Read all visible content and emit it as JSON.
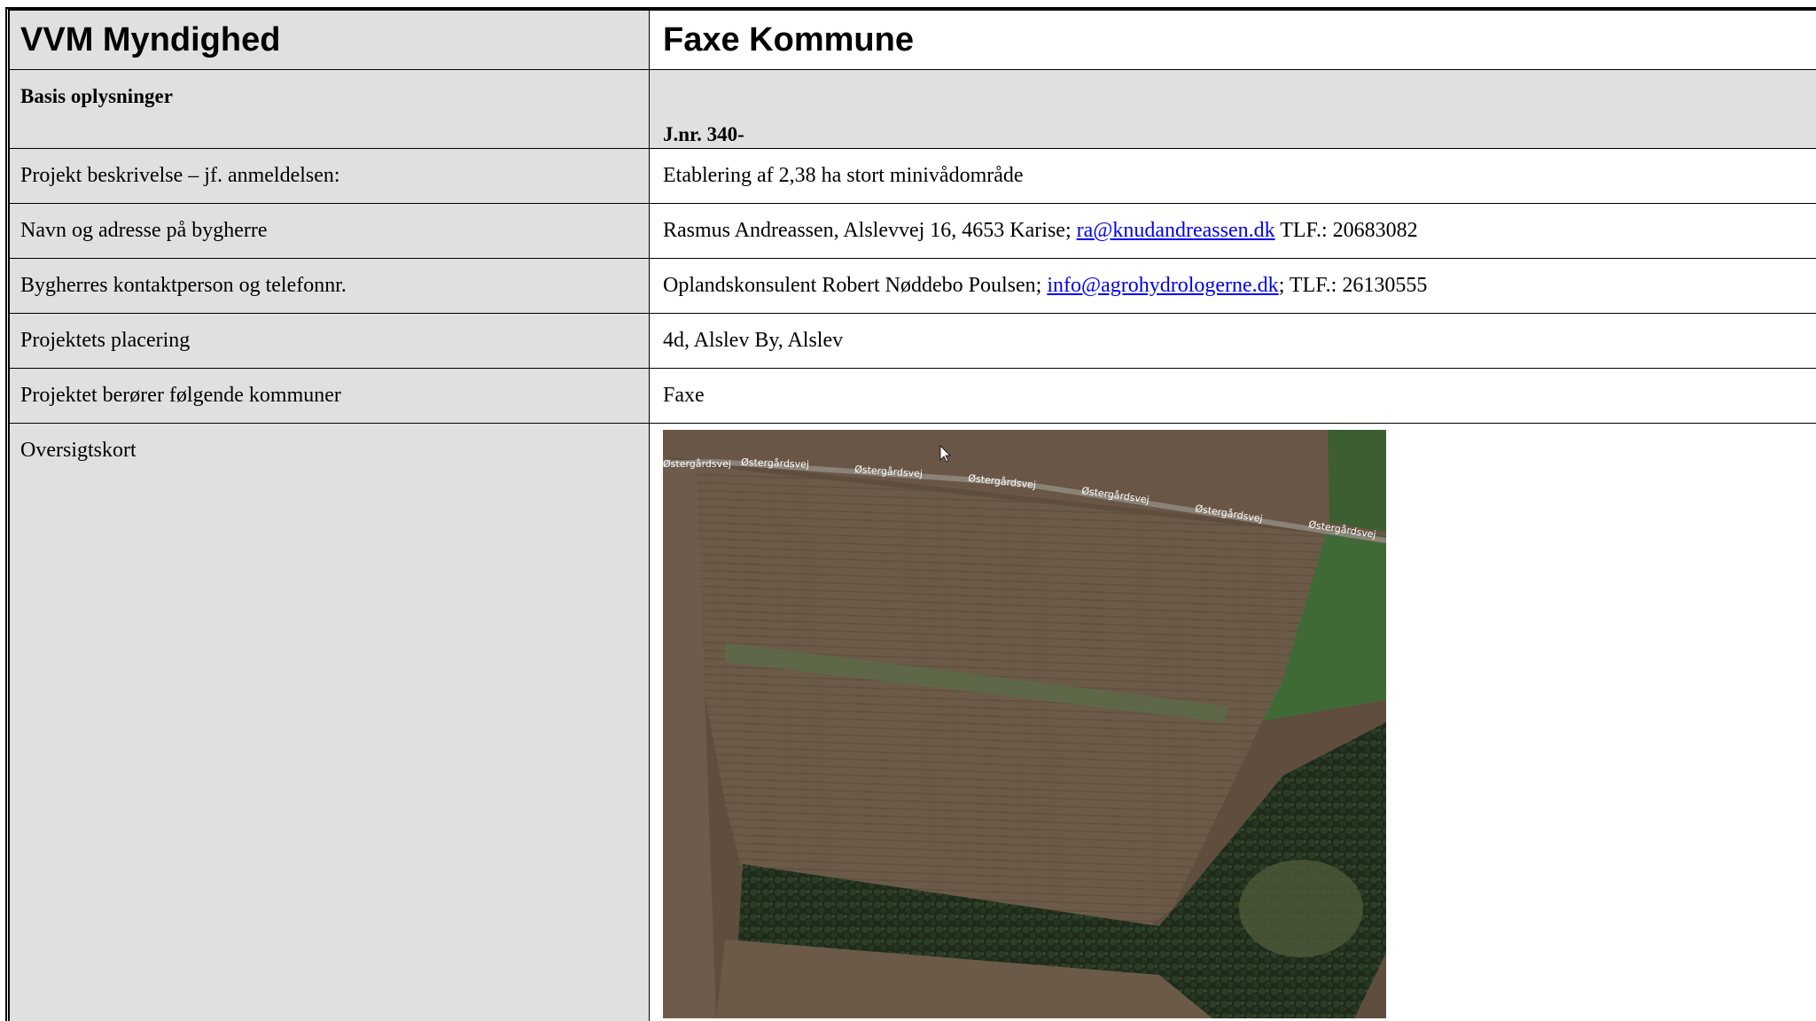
{
  "header": {
    "left": "VVM Myndighed",
    "right": "Faxe Kommune"
  },
  "basis": {
    "label": "Basis oplysninger",
    "jnr": "J.nr. 340-"
  },
  "rows": [
    {
      "label": "Projekt beskrivelse – jf. anmeldelsen:",
      "value": "Etablering af 2,38 ha stort minivådområde"
    },
    {
      "label": "Navn og adresse på bygherre",
      "value_pre": "Rasmus Andreassen, Alslevvej 16, 4653 Karise; ",
      "value_link": "ra@knudandreassen.dk",
      "value_post": " TLF.: 20683082"
    },
    {
      "label": "Bygherres kontaktperson og telefonnr.",
      "value_pre": "Oplandskonsulent Robert Nøddebo Poulsen; ",
      "value_link": "info@agrohydrologerne.dk",
      "value_post": "; TLF.: 26130555"
    },
    {
      "label": "Projektets placering",
      "value": "4d, Alslev By, Alslev"
    },
    {
      "label": "Projektet berører følgende kommuner",
      "value": "Faxe"
    }
  ],
  "map": {
    "label": "Oversigtskort",
    "road_label": "Østergårdsvej",
    "colors": {
      "field": "#6e5c4a",
      "forest": "#1f2e1c",
      "grass": "#3f6a36",
      "road": "#8a8378"
    }
  }
}
